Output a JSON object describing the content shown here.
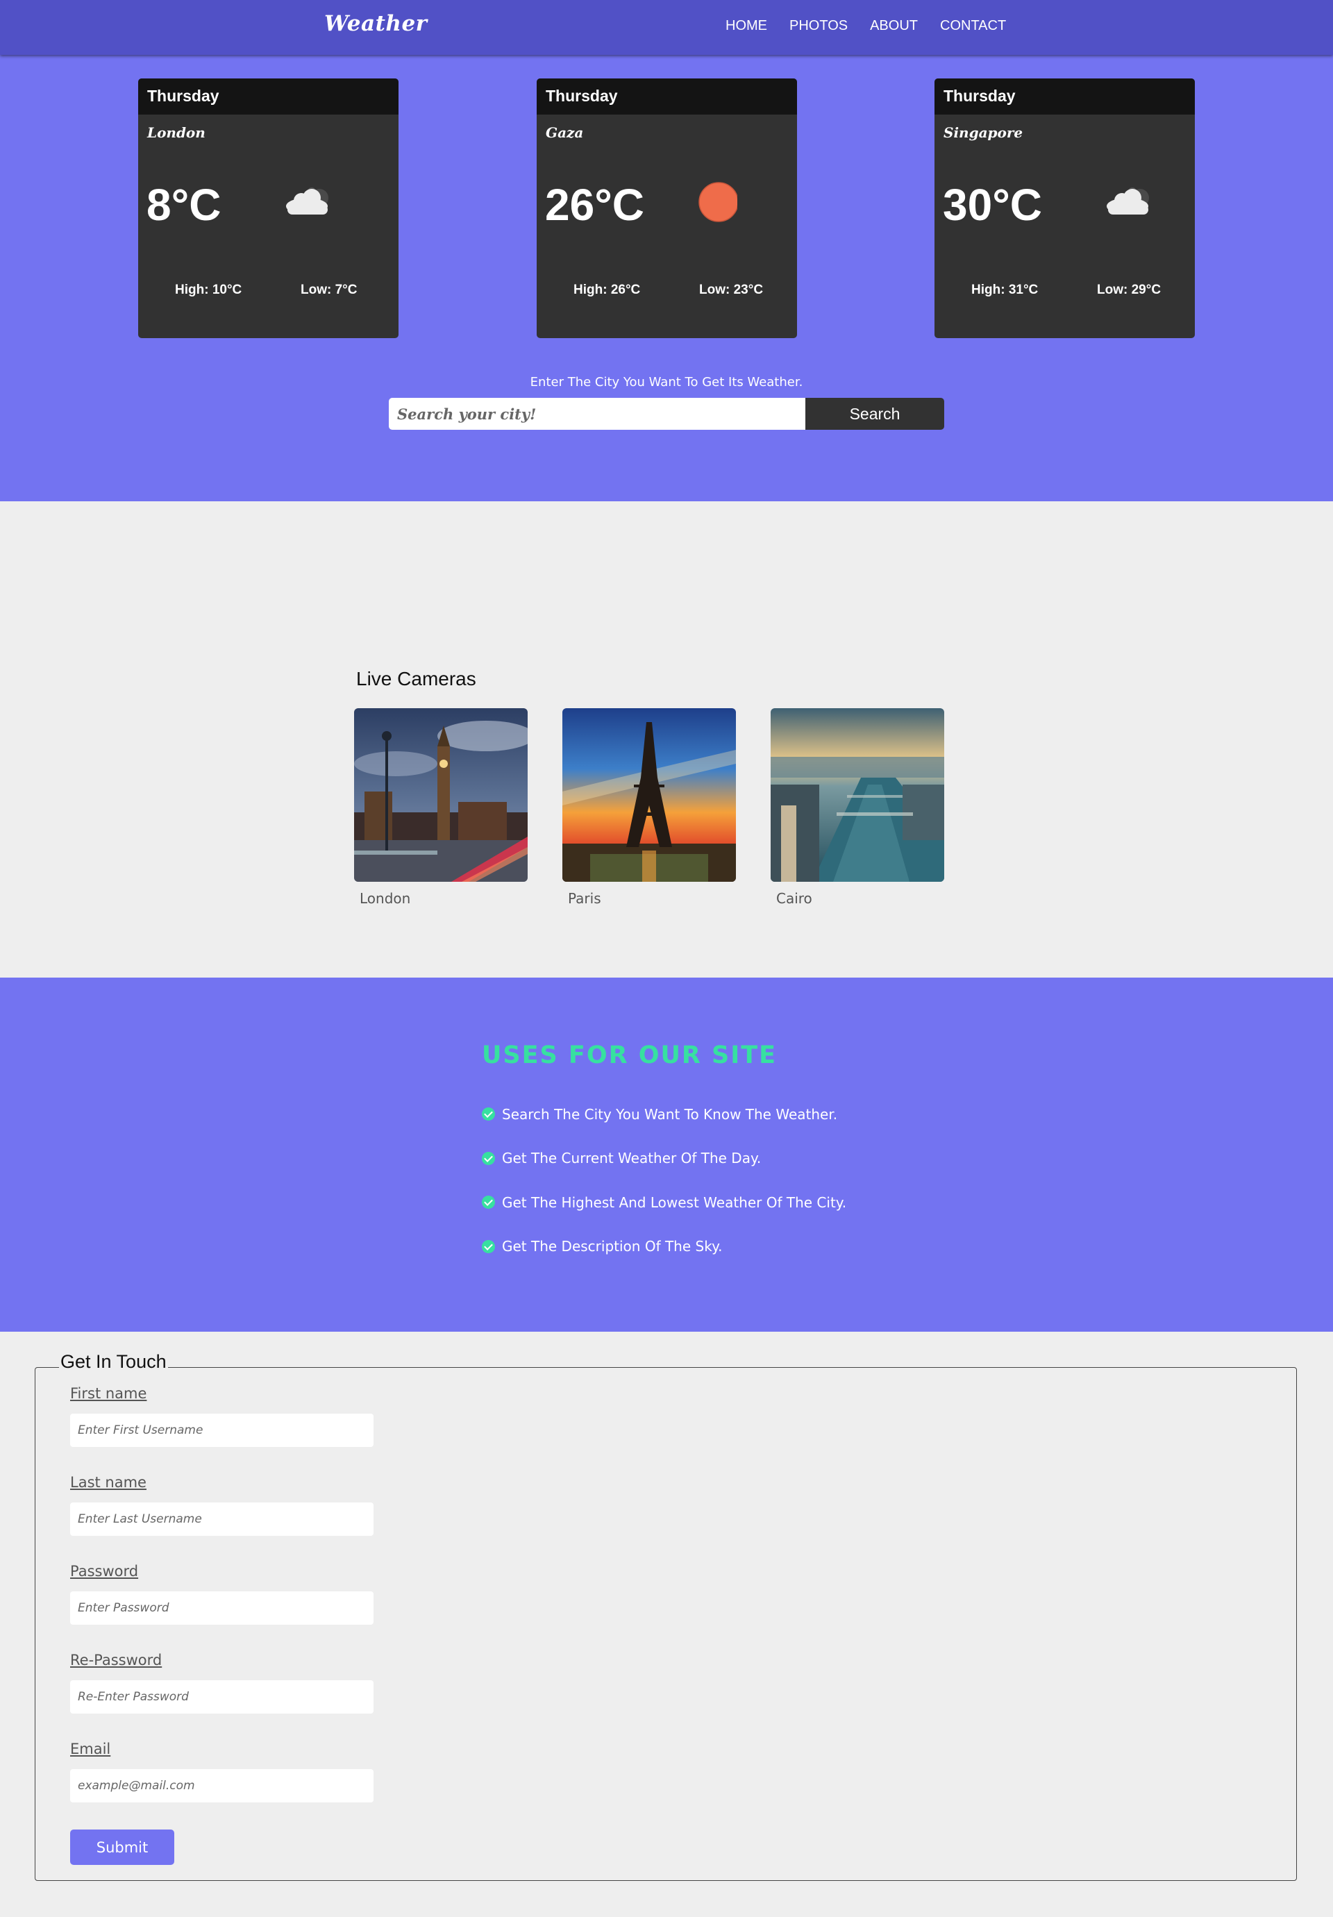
{
  "nav": {
    "brand": "Weather",
    "links": [
      "HOME",
      "PHOTOS",
      "ABOUT",
      "CONTACT"
    ]
  },
  "cards": [
    {
      "day": "Thursday",
      "city": "London",
      "temp": "8°C",
      "icon": "partly-cloudy-icon",
      "high": "High: 10°C",
      "low": "Low: 7°C"
    },
    {
      "day": "Thursday",
      "city": "Gaza",
      "temp": "26°C",
      "icon": "sun-icon",
      "high": "High: 26°C",
      "low": "Low: 23°C"
    },
    {
      "day": "Thursday",
      "city": "Singapore",
      "temp": "30°C",
      "icon": "partly-cloudy-icon",
      "high": "High: 31°C",
      "low": "Low: 29°C"
    }
  ],
  "search": {
    "prompt": "Enter The City You Want To Get Its Weather.",
    "placeholder": "Search your city!",
    "button": "Search"
  },
  "cameras": {
    "title": "Live Cameras",
    "items": [
      "London",
      "Paris",
      "Cairo"
    ]
  },
  "uses": {
    "title": "USES FOR OUR SITE",
    "items": [
      "Search The City You Want To Know The Weather.",
      "Get The Current Weather Of The Day.",
      "Get The Highest And Lowest Weather Of The City.",
      "Get The Description Of The Sky."
    ]
  },
  "contact": {
    "legend": "Get In Touch",
    "fields": [
      {
        "label": "First name",
        "placeholder": "Enter First Username"
      },
      {
        "label": "Last name",
        "placeholder": "Enter Last Username"
      },
      {
        "label": "Password",
        "placeholder": "Enter Password"
      },
      {
        "label": "Re-Password",
        "placeholder": "Re-Enter Password"
      },
      {
        "label": "Email",
        "placeholder": "example@mail.com"
      }
    ],
    "submit": "Submit"
  },
  "colors": {
    "nav": "#5151c6",
    "hero": "#7373f1",
    "card": "#323232",
    "accent_green": "#37e0a0",
    "sun": "#ef6c4a"
  }
}
